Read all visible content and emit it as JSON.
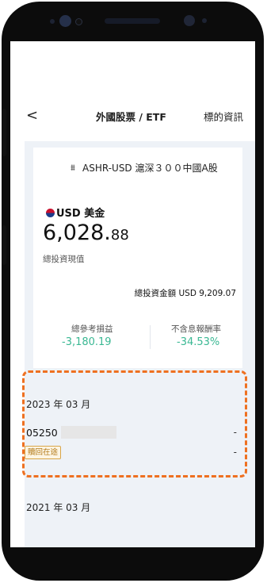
{
  "header": {
    "back_label": "<",
    "title": "外國股票 / ETF",
    "right_label": "標的資訊"
  },
  "fund": {
    "icon": "balance-icon",
    "name": "ASHR-USD 滬深３００中國A股"
  },
  "account": {
    "currency": "USD 美金",
    "amount_int": "6,028.",
    "amount_dec": "88",
    "amount_label": "總投資現值",
    "total_invest": "總投資金額 USD 9,209.07",
    "pnl_label": "總參考損益",
    "pnl_value": "-3,180.19",
    "return_label": "不含息報酬率",
    "return_value": "-34.53%"
  },
  "records": [
    {
      "date": "2023 年 03 月",
      "account_prefix": "05250",
      "status": "贖回在途",
      "value1": "-",
      "value2": "-"
    },
    {
      "date": "2021 年 03 月"
    }
  ],
  "colors": {
    "positive_green": "#3ab893",
    "highlight_orange": "#ee7020",
    "badge_border": "#d8a548"
  }
}
